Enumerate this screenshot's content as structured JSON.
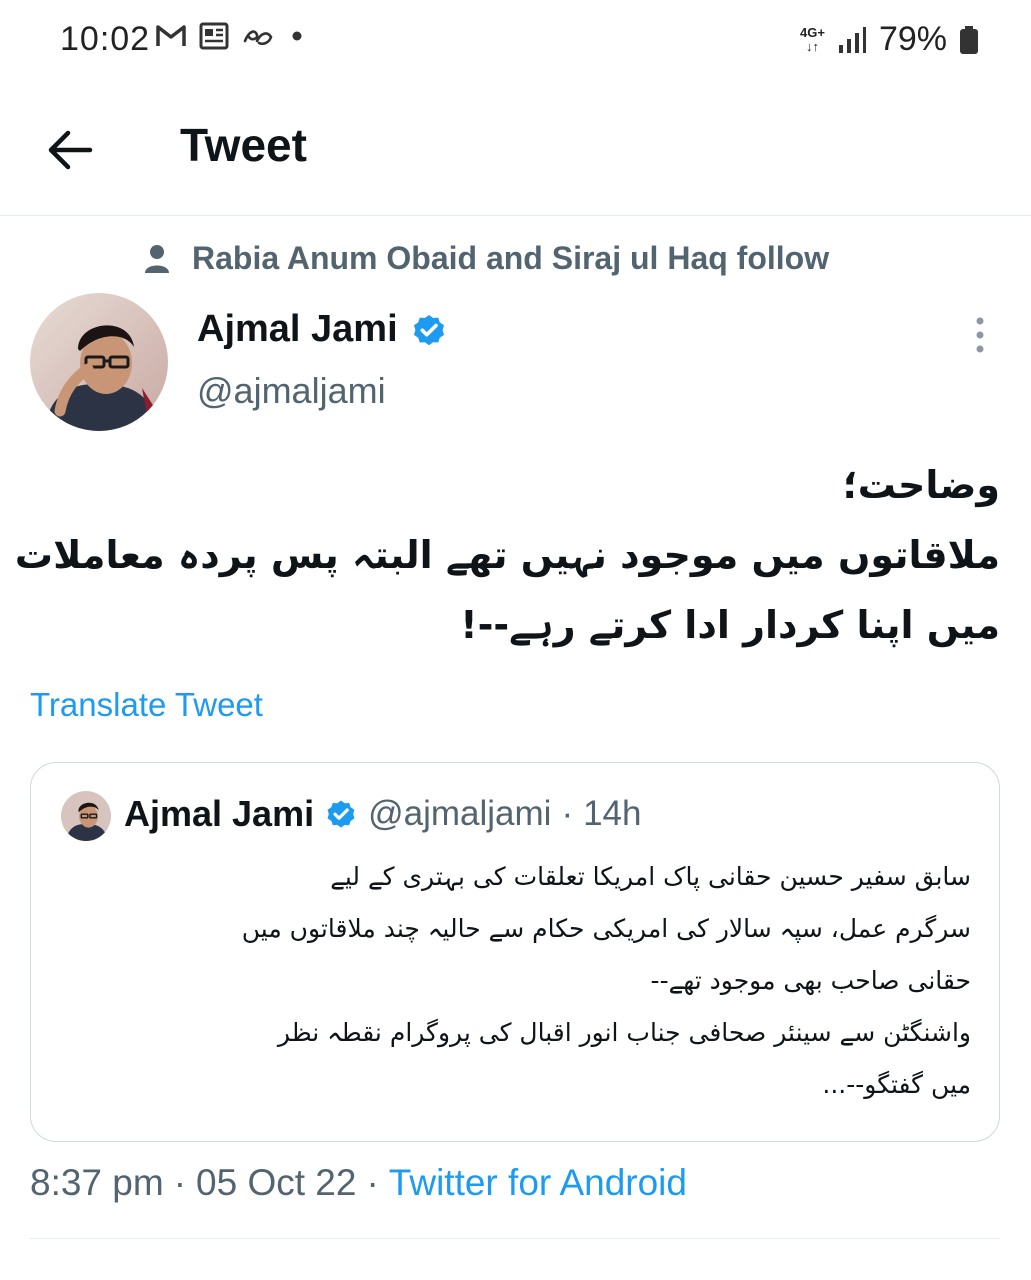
{
  "status_bar": {
    "time": "10:02",
    "battery": "79%",
    "network": "4G+",
    "icons": [
      "gmail-icon",
      "news-icon",
      "email-app-icon",
      "notification-dot-icon",
      "signal-icon",
      "battery-icon"
    ]
  },
  "header": {
    "title": "Tweet",
    "back_icon": "arrow-left-icon"
  },
  "social_context": {
    "icon": "person-icon",
    "text": "Rabia Anum Obaid and Siraj ul Haq follow"
  },
  "tweet": {
    "author_name": "Ajmal Jami",
    "author_handle": "@ajmaljami",
    "verified": true,
    "body_lines": [
      "وضاحت؛",
      "ملاقاتوں میں موجود نہیں تھے البتہ پس پردہ معاملات",
      "میں اپنا کردار ادا کرتے رہے--!"
    ],
    "translate_label": "Translate Tweet",
    "time": "8:37 pm",
    "date": "05 Oct 22",
    "source": "Twitter for Android",
    "separator": "·"
  },
  "quoted_tweet": {
    "author_name": "Ajmal Jami",
    "author_handle": "@ajmaljami",
    "separator": "·",
    "time_ago": "14h",
    "body_lines": [
      "سابق سفیر حسین حقانی پاک امریکا تعلقات کی بہتری کے لیے",
      "سرگرم عمل، سپہ سالار کی امریکی حکام سے حالیہ چند ملاقاتوں میں",
      "حقانی صاحب بھی موجود تھے--",
      "واشنگٹن سے سینئر صحافی جناب انور اقبال کی پروگرام نقطہ نظر",
      "میں گفتگو--..."
    ]
  },
  "colors": {
    "accent": "#1d9bf0",
    "text_primary": "#0f1419",
    "text_secondary": "#536471",
    "border": "#cfd9de"
  }
}
